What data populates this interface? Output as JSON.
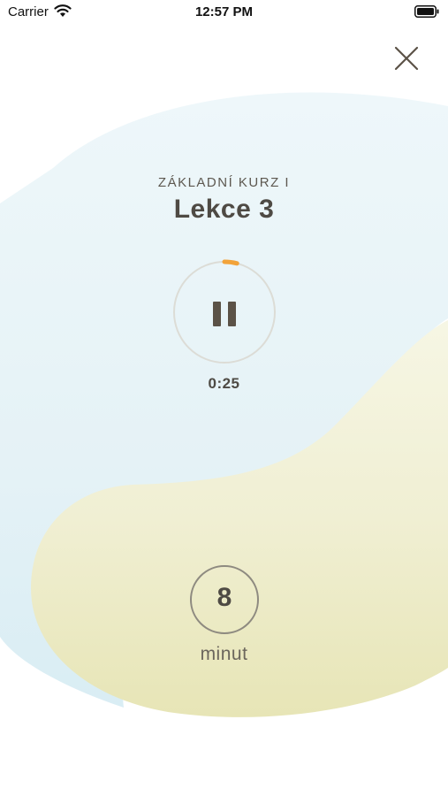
{
  "status_bar": {
    "carrier": "Carrier",
    "time": "12:57 PM",
    "wifi_icon": "wifi-icon",
    "battery_icon": "battery-icon"
  },
  "header": {
    "close_icon": "close-icon"
  },
  "lesson": {
    "course": "ZÁKLADNÍ KURZ I",
    "title": "Lekce 3"
  },
  "player": {
    "state_icon": "pause-icon",
    "elapsed": "0:25",
    "progress_fraction": 0.04
  },
  "duration": {
    "value": "8",
    "unit": "minut"
  },
  "colors": {
    "accent": "#f2a33a",
    "text": "#4e4a44",
    "ring": "#dcdcd6",
    "blob_blue": "#e6f4f8",
    "blob_yellow": "#eeeccb"
  }
}
